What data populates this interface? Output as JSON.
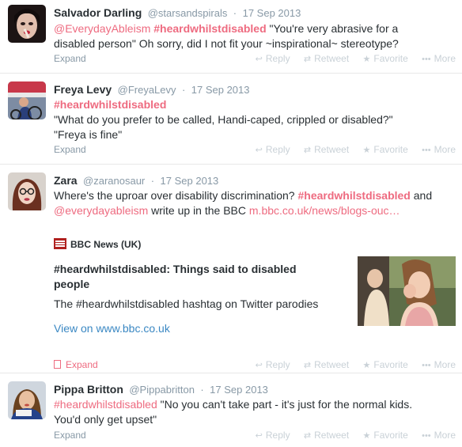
{
  "colors": {
    "accent": "#ee6b80",
    "link": "#3b88c3",
    "muted": "#8899a6"
  },
  "actions": {
    "reply": "Reply",
    "retweet": "Retweet",
    "favorite": "Favorite",
    "more": "More",
    "expand": "Expand"
  },
  "tweets": [
    {
      "name": "Salvador Darling",
      "handle": "@starsandspirals",
      "sep": "·",
      "date": "17 Sep 2013",
      "mention": "@EverydayAbleism",
      "hashtag": "#heardwhilstdisabled",
      "text_line1_rest": "\"You're very abrasive for a",
      "text_line2": "disabled person\" Oh sorry, did I not fit your ~inspirational~ stereotype?"
    },
    {
      "name": "Freya Levy",
      "handle": "@FreyaLevy",
      "sep": "·",
      "date": "17 Sep 2013",
      "hashtag": "#heardwhilstdisabled",
      "text_line2": "\"What do you prefer to be called, Handi-caped, crippled or disabled?\"",
      "text_line3": "\"Freya is fine\""
    },
    {
      "name": "Zara",
      "handle": "@zaranosaur",
      "sep": "·",
      "date": "17 Sep 2013",
      "text_line1_start": "Where's the uproar over disability discrimination?",
      "hashtag": "#heardwhilstdisabled",
      "text_line1_end": "and",
      "mention": "@everydayableism",
      "text_line2_mid": "write up in the BBC",
      "url": "m.bbc.co.uk/news/blogs-ouc…",
      "card": {
        "source": "BBC News (UK)",
        "title": "#heardwhilstdisabled: Things said to disabled people",
        "description": "The #heardwhilstdisabled hashtag on Twitter parodies",
        "link": "View on www.bbc.co.uk"
      }
    },
    {
      "name": "Pippa Britton",
      "handle": "@Pippabritton",
      "sep": "·",
      "date": "17 Sep 2013",
      "hashtag": "#heardwhilstdisabled",
      "text_line1_rest": "\"No you can't take part - it's just for the normal kids.",
      "text_line2": "You'd only get upset\""
    }
  ]
}
